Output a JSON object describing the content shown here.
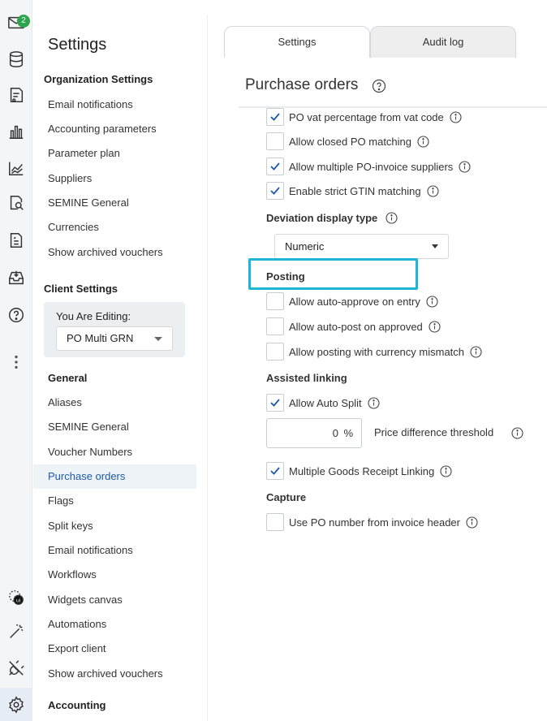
{
  "rail": {
    "mail_badge": "2",
    "icons": [
      "mail-icon",
      "database-icon",
      "receipt-icon",
      "bar-chart-icon",
      "line-chart-icon",
      "search-document-icon",
      "invoice-icon",
      "inbox-icon",
      "help-icon",
      "more-vertical-icon",
      "ui-badge-icon",
      "magic-wand-icon",
      "plugin-icon",
      "settings-icon"
    ]
  },
  "nav": {
    "title": "Settings",
    "org_section": "Organization Settings",
    "org_items": [
      "Email notifications",
      "Accounting parameters",
      "Parameter plan",
      "Suppliers",
      "SEMINE General",
      "Currencies",
      "Show archived vouchers"
    ],
    "client_section": "Client Settings",
    "editing_label": "You Are Editing:",
    "editing_value": "PO Multi GRN",
    "general_section": "General",
    "general_items": [
      "Aliases",
      "SEMINE General",
      "Voucher Numbers",
      "Purchase orders",
      "Flags",
      "Split keys",
      "Email notifications",
      "Workflows",
      "Widgets canvas",
      "Automations",
      "Export client",
      "Show archived vouchers"
    ],
    "accounting_section": "Accounting"
  },
  "main": {
    "tabs": [
      "Settings",
      "Audit log"
    ],
    "title": "Purchase orders",
    "options_top": [
      {
        "label": "PO vat percentage from vat code",
        "checked": true
      },
      {
        "label": "Allow closed PO matching",
        "checked": false
      },
      {
        "label": "Allow multiple PO-invoice suppliers",
        "checked": true
      },
      {
        "label": "Enable strict GTIN matching",
        "checked": true
      }
    ],
    "deviation_label": "Deviation display type",
    "deviation_value": "Numeric",
    "posting_label": "Posting",
    "posting_options": [
      {
        "label": "Allow auto-approve on entry",
        "checked": false
      },
      {
        "label": "Allow auto-post on approved",
        "checked": false
      },
      {
        "label": "Allow posting with currency mismatch",
        "checked": false
      }
    ],
    "assisted_label": "Assisted linking",
    "auto_split": {
      "label": "Allow Auto Split",
      "checked": true
    },
    "price_threshold": {
      "value": "0",
      "unit": "%",
      "label": "Price difference threshold"
    },
    "multi_grn": {
      "label": "Multiple Goods Receipt Linking",
      "checked": true
    },
    "capture_label": "Capture",
    "capture_option": {
      "label": "Use PO number from invoice header",
      "checked": false
    }
  },
  "colors": {
    "accent": "#1e5aa8",
    "highlight": "#1fb6d6",
    "badge": "#2ea44f"
  }
}
